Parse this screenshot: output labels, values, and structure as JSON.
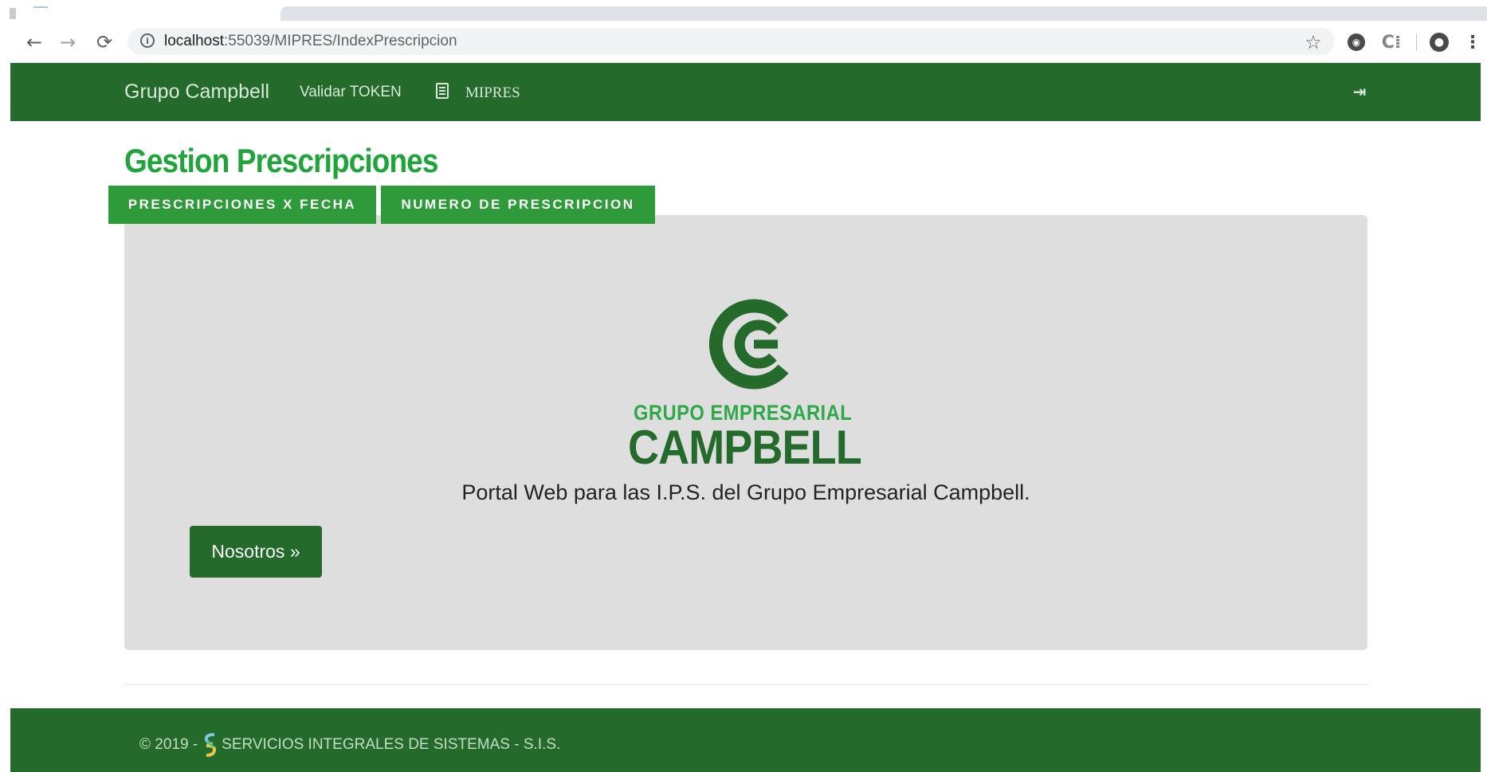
{
  "browser": {
    "url_host": "localhost",
    "url_rest": ":55039/MIPRES/IndexPrescripcion",
    "icons": [
      "back-icon",
      "forward-icon",
      "reload-icon",
      "info-icon",
      "star-icon",
      "extension-icon",
      "extension-c-icon",
      "profile-icon",
      "menu-icon"
    ]
  },
  "navbar": {
    "brand": "Grupo Campbell",
    "validar_label": "Validar TOKEN",
    "mipres_label": "MIPRES",
    "color": "#236a2b"
  },
  "page": {
    "title": "Gestion Prescripciones",
    "title_color": "#1fa33a"
  },
  "tabs": [
    {
      "label": "PRESCRIPCIONES X FECHA"
    },
    {
      "label": "NUMERO DE PRESCRIPCION"
    }
  ],
  "jumbotron": {
    "logo_sub": "GRUPO EMPRESARIAL",
    "logo_main": "CAMPBELL",
    "lead": "Portal Web para las I.P.S. del Grupo Empresarial Campbell.",
    "button_label": "Nosotros »",
    "background": "#dedede"
  },
  "footer": {
    "prefix": "© 2019 -",
    "company": "SERVICIOS INTEGRALES DE SISTEMAS - S.I.S."
  }
}
